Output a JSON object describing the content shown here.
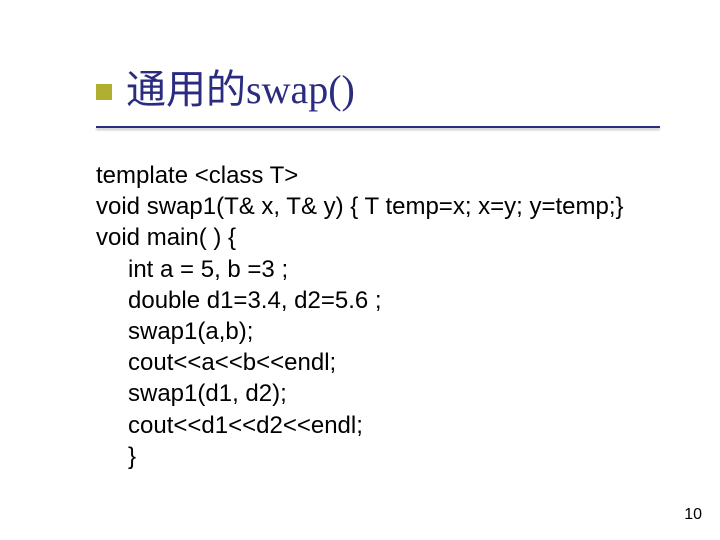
{
  "title": "通用的swap()",
  "code": {
    "l1": "template <class T>",
    "l2": "void swap1(T& x, T& y) { T temp=x; x=y; y=temp;}",
    "l3": "void main( ) {",
    "l4": "int a = 5, b =3 ;",
    "l5": "double d1=3.4, d2=5.6 ;",
    "l6": "swap1(a,b);",
    "l7": "cout<<a<<b<<endl;",
    "l8": "swap1(d1, d2);",
    "l9": "cout<<d1<<d2<<endl;",
    "l10": "}"
  },
  "page_number": "10"
}
